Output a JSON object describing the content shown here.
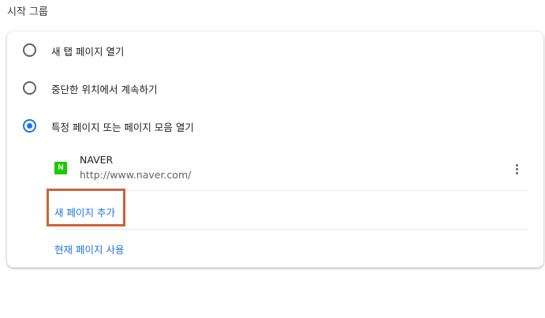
{
  "section": {
    "title": "시작 그룹"
  },
  "options": [
    {
      "label": "새 탭 페이지 열기",
      "checked": false
    },
    {
      "label": "중단한 위치에서 계속하기",
      "checked": false
    },
    {
      "label": "특정 페이지 또는 페이지 모음 열기",
      "checked": true
    }
  ],
  "pages": [
    {
      "favicon_letter": "N",
      "favicon_color": "#1ec800",
      "name": "NAVER",
      "url": "http://www.naver.com/",
      "menu_icon": "more-vert-icon"
    }
  ],
  "actions": {
    "add_page": "새 페이지 추가",
    "use_current": "현재 페이지 사용"
  },
  "colors": {
    "accent": "#1a73e8",
    "highlight": "#d0613a"
  }
}
